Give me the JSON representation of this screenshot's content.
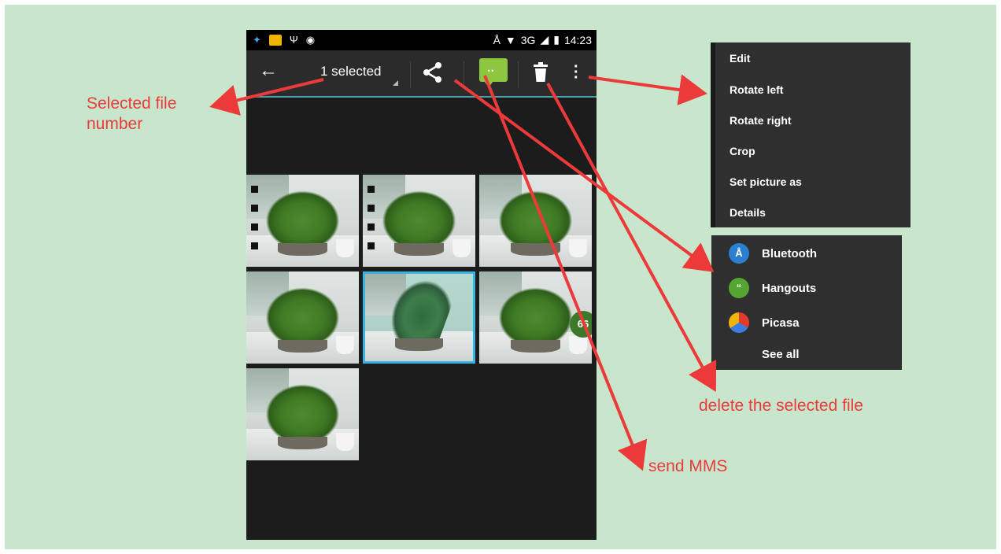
{
  "status_bar": {
    "network": "3G",
    "time": "14:23",
    "icons": [
      "bird-notification-icon",
      "app-notification-icon",
      "usb-icon",
      "debug-icon",
      "bluetooth-icon",
      "wifi-icon",
      "signal-icon",
      "battery-icon"
    ]
  },
  "action_bar": {
    "selection_count": "1 selected",
    "icons": [
      "back-arrow-icon",
      "share-icon",
      "messaging-icon",
      "trash-icon",
      "overflow-menu-icon"
    ]
  },
  "grid": {
    "columns": 3,
    "photos": [
      {
        "selected": false
      },
      {
        "selected": false
      },
      {
        "selected": false
      },
      {
        "selected": false
      },
      {
        "selected": true
      },
      {
        "selected": false,
        "badge": "66"
      },
      {
        "selected": false
      }
    ]
  },
  "overflow_menu": {
    "items": [
      "Edit",
      "Rotate left",
      "Rotate right",
      "Crop",
      "Set picture as",
      "Details"
    ]
  },
  "share_menu": {
    "items": [
      {
        "label": "Bluetooth",
        "icon": "bluetooth-icon"
      },
      {
        "label": "Hangouts",
        "icon": "hangouts-icon"
      },
      {
        "label": "Picasa",
        "icon": "picasa-icon"
      },
      {
        "label": "See all",
        "icon": ""
      }
    ]
  },
  "annotations": {
    "selected_line1": "Selected file",
    "selected_line2": "number",
    "delete": "delete the selected file",
    "mms": "send MMS"
  },
  "colors": {
    "background": "#c8e6cc",
    "annotation": "#ec3a3a",
    "selection_border": "#33b5e5",
    "message_icon": "#8dc63f"
  }
}
